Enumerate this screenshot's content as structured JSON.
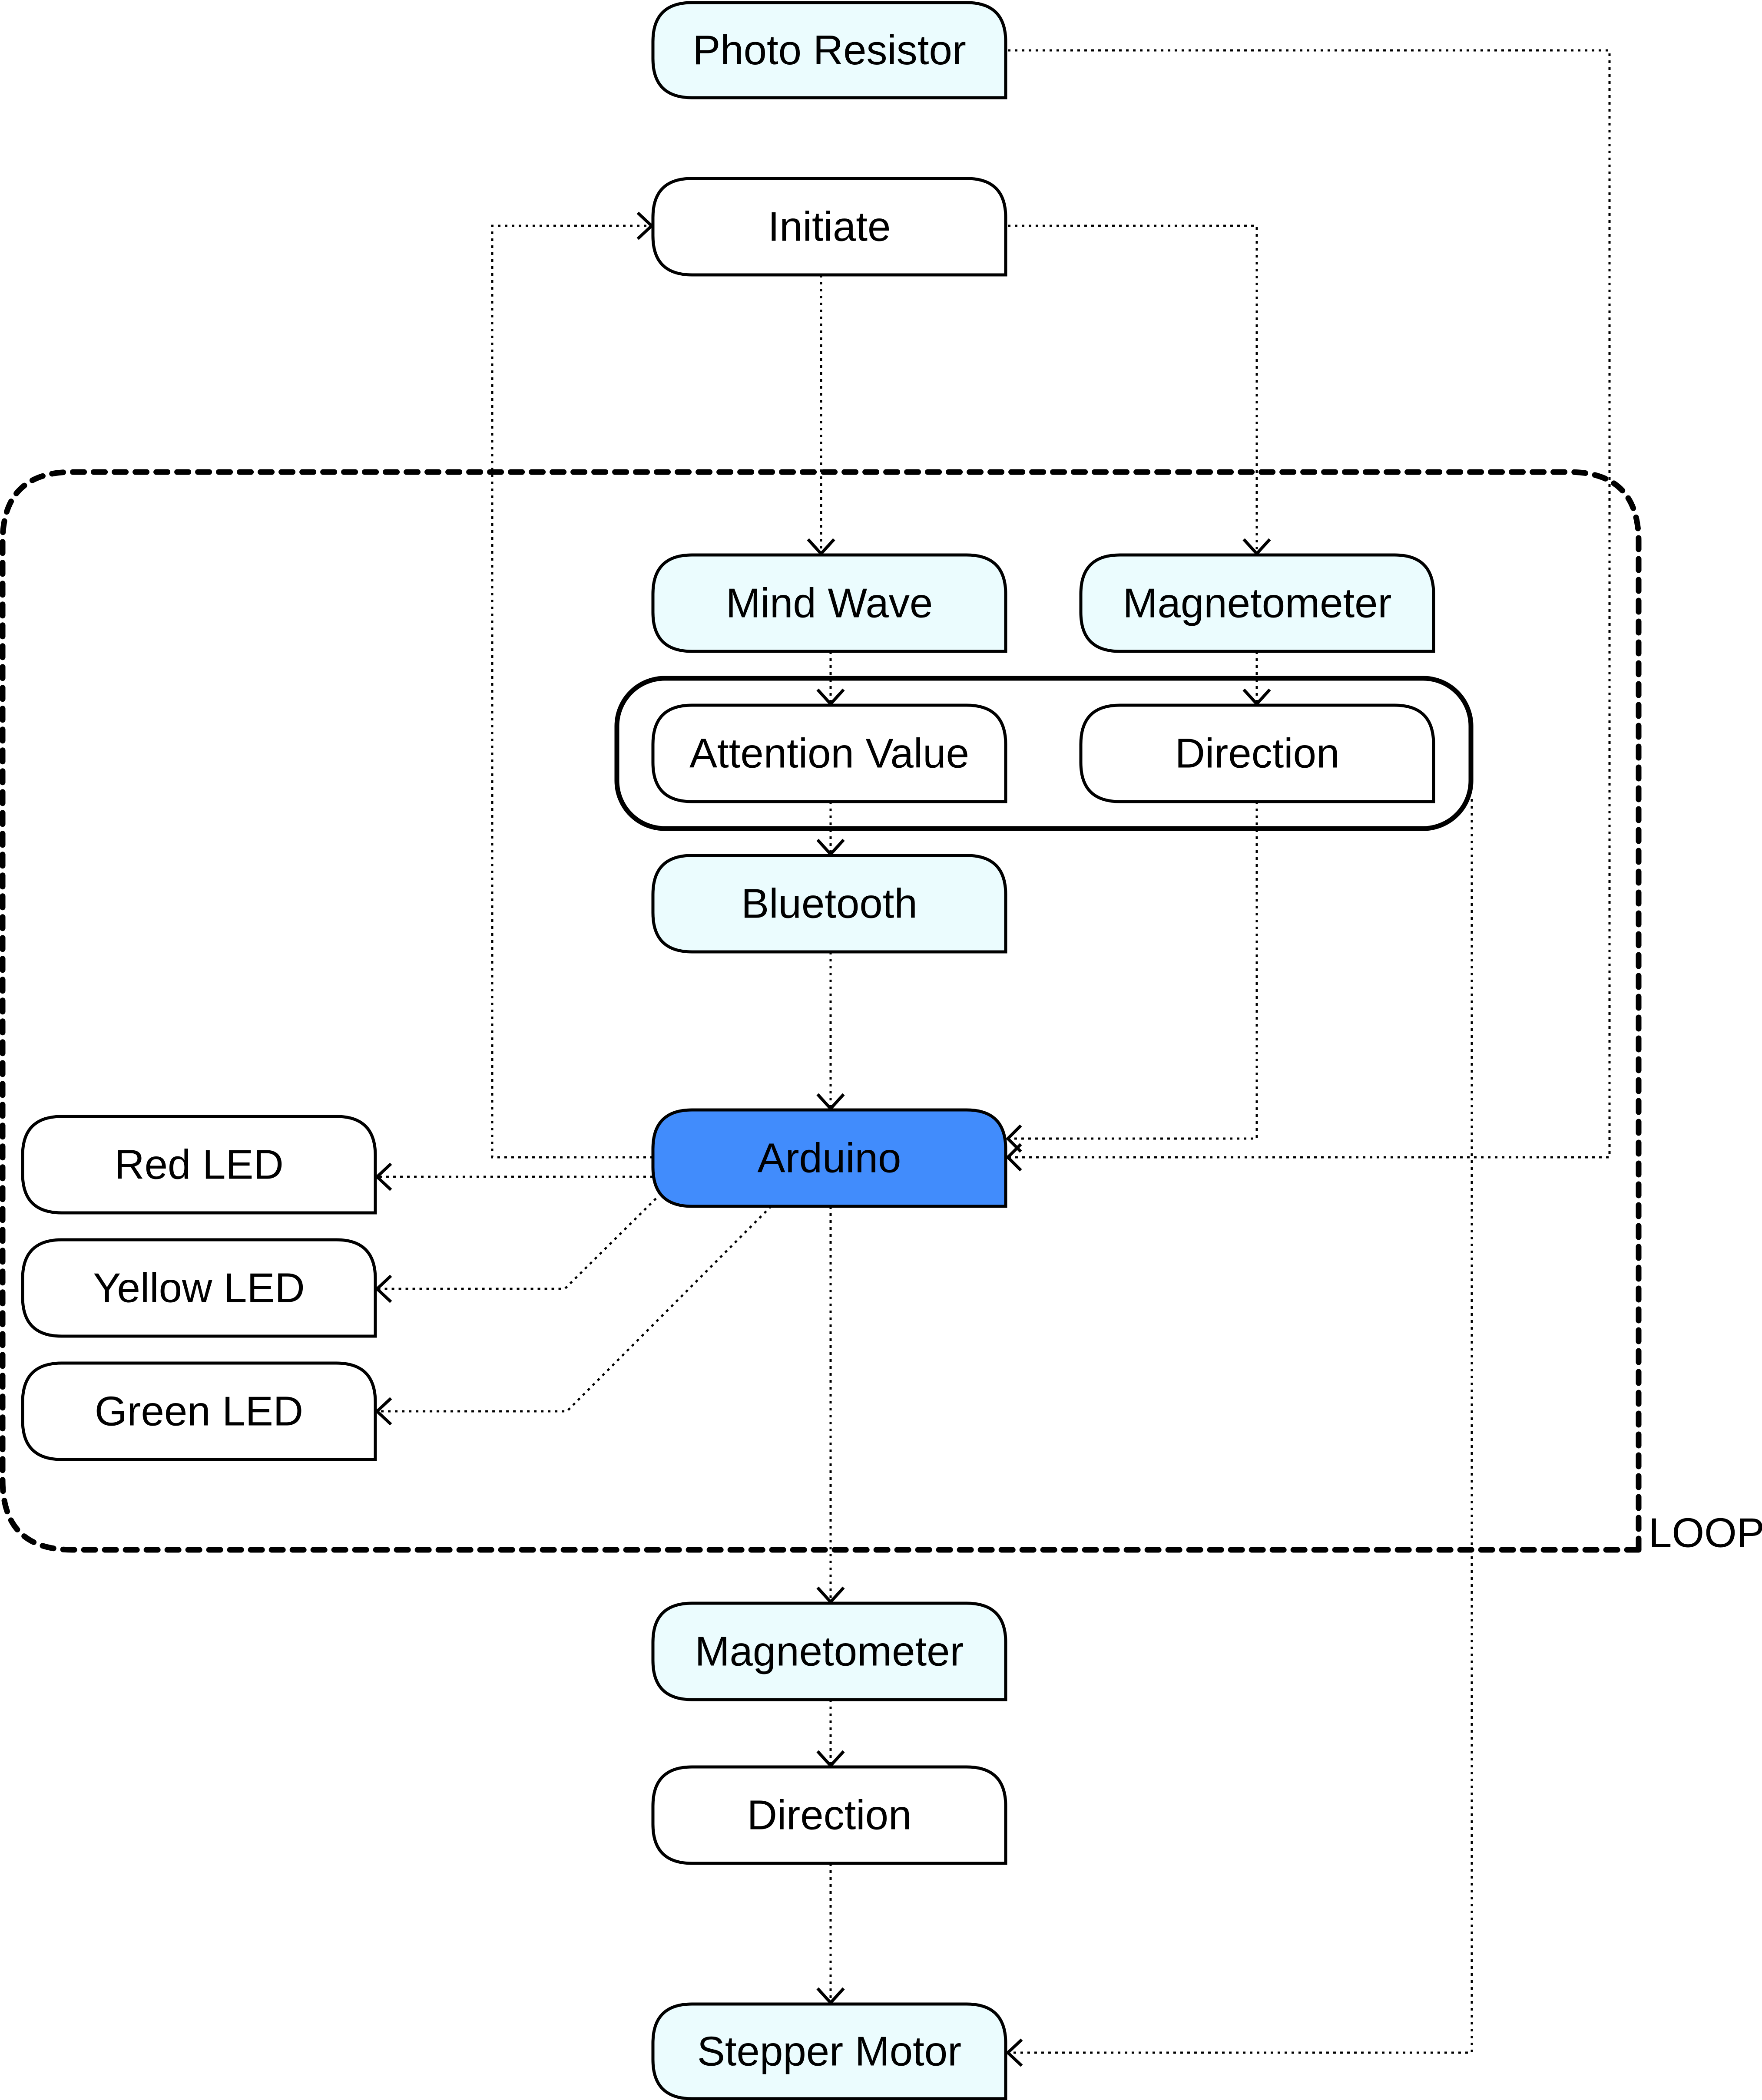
{
  "diagram": {
    "colors": {
      "sensor_fill": "#EBFCFE",
      "process_fill": "#FFFFFF",
      "controller_fill": "#418CFC",
      "stroke": "#000000"
    },
    "loop_label": "LOOP",
    "nodes": {
      "photo_resistor": {
        "label": "Photo Resistor",
        "kind": "sensor"
      },
      "initiate": {
        "label": "Initiate",
        "kind": "process"
      },
      "mind_wave": {
        "label": "Mind Wave",
        "kind": "sensor"
      },
      "magnetometer_top": {
        "label": "Magnetometer",
        "kind": "sensor"
      },
      "attention_value": {
        "label": "Attention Value",
        "kind": "process"
      },
      "direction_top": {
        "label": "Direction",
        "kind": "process"
      },
      "bluetooth": {
        "label": "Bluetooth",
        "kind": "sensor"
      },
      "arduino": {
        "label": "Arduino",
        "kind": "controller"
      },
      "red_led": {
        "label": "Red LED",
        "kind": "process"
      },
      "yellow_led": {
        "label": "Yellow LED",
        "kind": "process"
      },
      "green_led": {
        "label": "Green LED",
        "kind": "process"
      },
      "magnetometer_bottom": {
        "label": "Magnetometer",
        "kind": "sensor"
      },
      "direction_bottom": {
        "label": "Direction",
        "kind": "process"
      },
      "stepper_motor": {
        "label": "Stepper Motor",
        "kind": "sensor"
      }
    },
    "edges": [
      {
        "from": "Initiate",
        "to": "Mind Wave"
      },
      {
        "from": "Initiate",
        "to": "Magnetometer"
      },
      {
        "from": "Mind Wave",
        "to": "Attention Value"
      },
      {
        "from": "Magnetometer",
        "to": "Direction"
      },
      {
        "from": "Attention Value",
        "to": "Bluetooth"
      },
      {
        "from": "Bluetooth",
        "to": "Arduino"
      },
      {
        "from": "Direction",
        "to": "Arduino"
      },
      {
        "from": "Photo Resistor",
        "to": "Arduino"
      },
      {
        "from": "Arduino",
        "to": "Initiate"
      },
      {
        "from": "Arduino",
        "to": "Red LED"
      },
      {
        "from": "Arduino",
        "to": "Yellow LED"
      },
      {
        "from": "Arduino",
        "to": "Green LED"
      },
      {
        "from": "Arduino",
        "to": "Magnetometer (bottom)"
      },
      {
        "from": "Magnetometer (bottom)",
        "to": "Direction (bottom)"
      },
      {
        "from": "Direction (bottom)",
        "to": "Stepper Motor"
      },
      {
        "from": "Attention/Direction group",
        "to": "Stepper Motor"
      }
    ]
  }
}
